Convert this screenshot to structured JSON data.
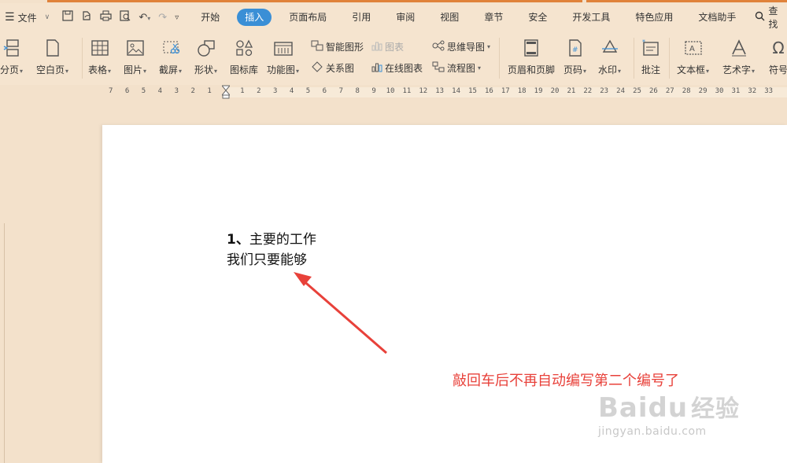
{
  "menubar": {
    "file_label": "文件",
    "tabs": [
      {
        "label": "开始",
        "active": false
      },
      {
        "label": "插入",
        "active": true
      },
      {
        "label": "页面布局",
        "active": false
      },
      {
        "label": "引用",
        "active": false
      },
      {
        "label": "审阅",
        "active": false
      },
      {
        "label": "视图",
        "active": false
      },
      {
        "label": "章节",
        "active": false
      },
      {
        "label": "安全",
        "active": false
      },
      {
        "label": "开发工具",
        "active": false
      },
      {
        "label": "特色应用",
        "active": false
      },
      {
        "label": "文档助手",
        "active": false
      }
    ],
    "search_label": "查找"
  },
  "ribbon": {
    "page_break": "分页",
    "blank_page": "空白页",
    "table": "表格",
    "picture": "图片",
    "screenshot": "截屏",
    "shape": "形状",
    "icon_library": "图标库",
    "function_chart": "功能图",
    "smart_art": "智能图形",
    "chart": "图表",
    "relation": "关系图",
    "online_chart": "在线图表",
    "mind_map": "思维导图",
    "flowchart": "流程图",
    "header_footer": "页眉和页脚",
    "page_number": "页码",
    "watermark": "水印",
    "comment": "批注",
    "text_box": "文本框",
    "word_art": "艺术字",
    "symbol": "符号"
  },
  "ruler": {
    "left_ticks": [
      "7",
      "6",
      "5",
      "4",
      "3",
      "2",
      "1"
    ],
    "right_ticks": [
      "1",
      "2",
      "3",
      "4",
      "5",
      "6",
      "7",
      "8",
      "9",
      "10",
      "11",
      "12",
      "13",
      "14",
      "15",
      "16",
      "17",
      "18",
      "19",
      "20",
      "21",
      "22",
      "23",
      "24",
      "25",
      "26",
      "27",
      "28",
      "29",
      "30",
      "31",
      "32",
      "33"
    ]
  },
  "document": {
    "line1_number": "1、",
    "line1_text": "主要的工作",
    "line2_text": "我们只要能够"
  },
  "annotation": {
    "text": "敲回车后不再自动编写第二个编号了",
    "color": "#e8413a"
  },
  "watermark": {
    "brand": "Baidu",
    "brand_cn": "经验",
    "url": "jingyan.baidu.com"
  },
  "colors": {
    "accent": "#3a8fd6",
    "background": "#f3e1cb"
  }
}
